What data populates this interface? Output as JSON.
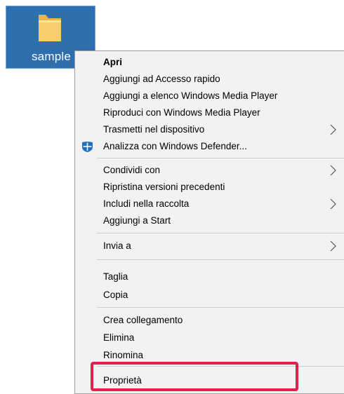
{
  "desktop": {
    "icon_label": "sample",
    "icon": "folder-icon",
    "selection_color": "#2e6fae"
  },
  "menu": {
    "items": [
      {
        "label": "Apri",
        "bold": true
      },
      {
        "label": "Aggiungi ad Accesso rapido"
      },
      {
        "label": "Aggiungi a elenco Windows Media Player"
      },
      {
        "label": "Riproduci con Windows Media Player"
      },
      {
        "label": "Trasmetti nel dispositivo",
        "submenu": true
      },
      {
        "label": "Analizza con Windows Defender...",
        "icon": "windows-defender-icon"
      },
      {
        "label": "Condividi con",
        "submenu": true
      },
      {
        "label": "Ripristina versioni precedenti"
      },
      {
        "label": "Includi nella raccolta",
        "submenu": true
      },
      {
        "label": "Aggiungi a Start"
      },
      {
        "label": "Invia a",
        "submenu": true
      },
      {
        "label": "Taglia"
      },
      {
        "label": "Copia"
      },
      {
        "label": "Crea collegamento"
      },
      {
        "label": "Elimina"
      },
      {
        "label": "Rinomina"
      },
      {
        "label": "Proprietà",
        "highlighted": true
      }
    ]
  },
  "highlight_color": "#e2204a"
}
